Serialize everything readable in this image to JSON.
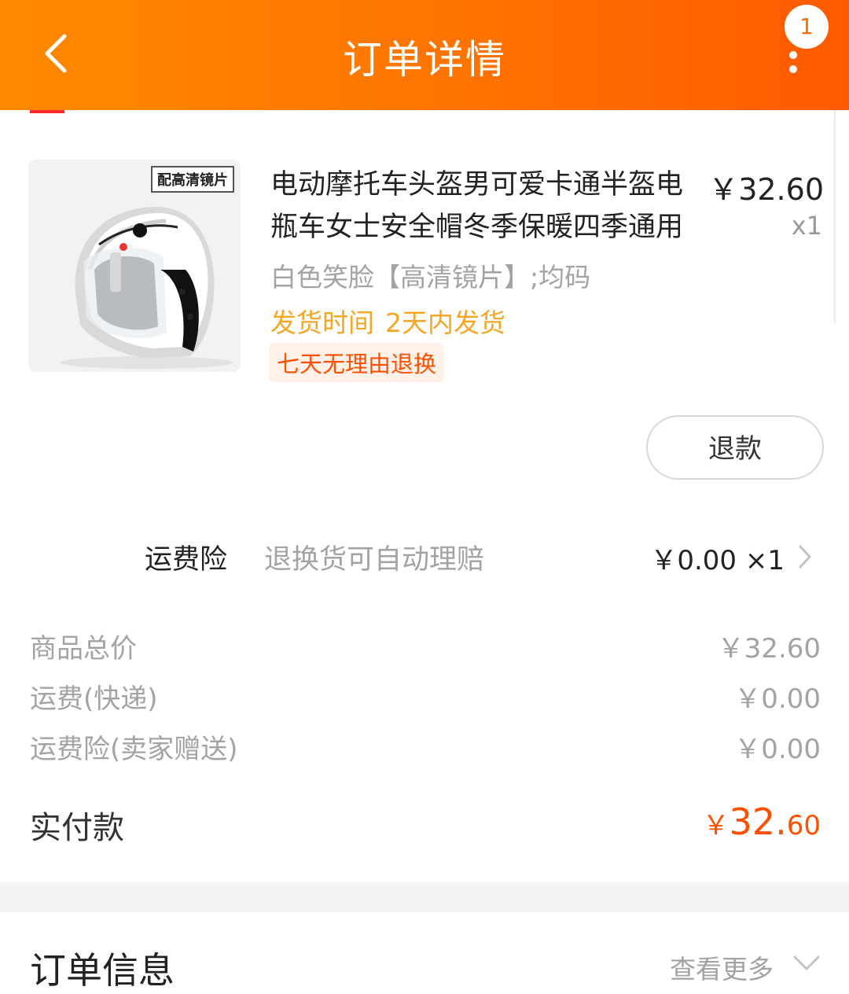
{
  "header": {
    "title": "订单详情",
    "badge_count": "1",
    "bg_gradient": [
      "#ff8a00",
      "#ff5a00"
    ],
    "back_icon": "chevron-left-icon",
    "more_icon": "more-vertical-icon"
  },
  "product": {
    "image_tag": "配高清镜片",
    "title": "电动摩托车头盔男可爱卡通半盔电瓶车女士安全帽冬季保暖四季通用",
    "price": "￥32.60",
    "qty": "x1",
    "spec": "白色笑脸【高清镜片】;均码",
    "ship_label": "发货时间",
    "ship_value": "2天内发货",
    "return_tag": "七天无理由退换",
    "refund_button": "退款"
  },
  "insurance": {
    "label": "运费险",
    "desc": "退换货可自动理赔",
    "value": "￥0.00 ×1"
  },
  "costs": [
    {
      "label": "商品总价",
      "value": "￥32.60"
    },
    {
      "label": "运费(快递)",
      "value": "￥0.00"
    },
    {
      "label": "运费险(卖家赠送)",
      "value": "￥0.00"
    }
  ],
  "paid": {
    "label": "实付款",
    "symbol": "￥",
    "integer": "32.",
    "decimal": "60"
  },
  "order_info": {
    "title": "订单信息",
    "more": "查看更多"
  },
  "colors": {
    "accent": "#ff5000",
    "ship_time": "#f5a623",
    "muted": "#a3a3a3"
  }
}
